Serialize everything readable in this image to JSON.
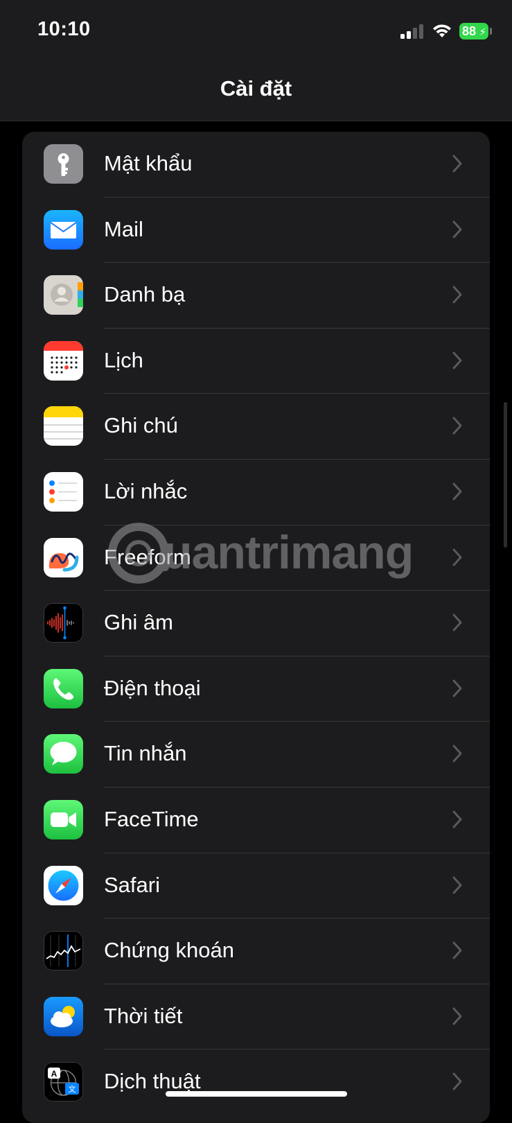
{
  "status_bar": {
    "time": "10:10",
    "battery": "88"
  },
  "header": {
    "title": "Cài đặt"
  },
  "watermark": {
    "text": "uantrimang"
  },
  "colors": {
    "background": "#000000",
    "group": "#1c1c1e",
    "separator": "#38383a",
    "chevron": "#5a5a5e",
    "battery": "#32d74b"
  },
  "settings": {
    "items": [
      {
        "label": "Mật khẩu",
        "icon": "key-icon"
      },
      {
        "label": "Mail",
        "icon": "mail-icon"
      },
      {
        "label": "Danh bạ",
        "icon": "contacts-icon"
      },
      {
        "label": "Lịch",
        "icon": "calendar-icon"
      },
      {
        "label": "Ghi chú",
        "icon": "notes-icon"
      },
      {
        "label": "Lời nhắc",
        "icon": "reminders-icon"
      },
      {
        "label": "Freeform",
        "icon": "freeform-icon"
      },
      {
        "label": "Ghi âm",
        "icon": "voice-memos-icon"
      },
      {
        "label": "Điện thoại",
        "icon": "phone-icon"
      },
      {
        "label": "Tin nhắn",
        "icon": "messages-icon"
      },
      {
        "label": "FaceTime",
        "icon": "facetime-icon"
      },
      {
        "label": "Safari",
        "icon": "safari-icon"
      },
      {
        "label": "Chứng khoán",
        "icon": "stocks-icon"
      },
      {
        "label": "Thời tiết",
        "icon": "weather-icon"
      },
      {
        "label": "Dịch thuật",
        "icon": "translate-icon"
      }
    ]
  }
}
